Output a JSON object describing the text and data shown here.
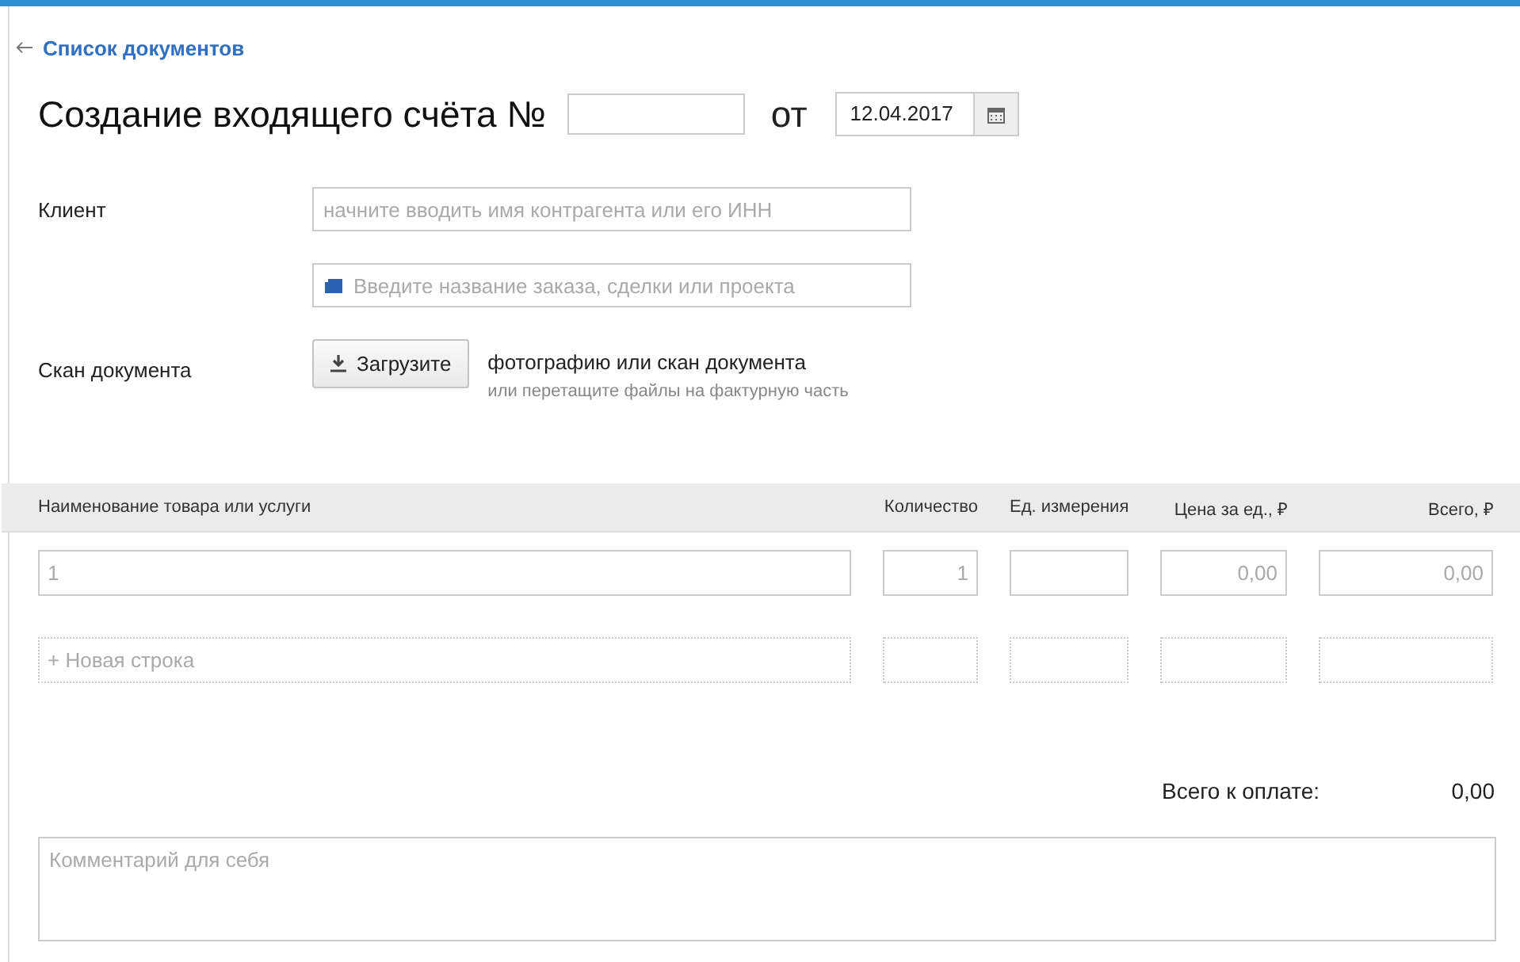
{
  "back_link": {
    "label": "Список документов"
  },
  "header": {
    "title": "Создание входящего счёта №",
    "date_label": "от",
    "date": "12.04.2017"
  },
  "client": {
    "label": "Клиент",
    "placeholder": "начните вводить имя контрагента или его ИНН"
  },
  "project": {
    "placeholder": "Введите название заказа, сделки или проекта"
  },
  "scan": {
    "label": "Скан документа",
    "button": "Загрузите",
    "text": "фотографию или скан документа",
    "hint": "или перетащите файлы на фактурную часть"
  },
  "table": {
    "columns": [
      "Наименование товара или услуги",
      "Количество",
      "Ед. измерения",
      "Цена за ед., ₽",
      "Всего, ₽"
    ],
    "rows": [
      {
        "kind": "item",
        "cells": [
          {
            "placeholder": "1"
          },
          {
            "placeholder": "1"
          },
          {},
          {
            "placeholder": "0,00"
          },
          {
            "placeholder": "0,00"
          }
        ]
      },
      {
        "kind": "new",
        "cells": [
          {
            "placeholder": "+ Новая строка"
          },
          {},
          {},
          {},
          {}
        ]
      }
    ]
  },
  "total": {
    "label": "Всего к оплате:",
    "value": "0,00"
  },
  "comment": {
    "placeholder": "Комментарий для себя"
  }
}
